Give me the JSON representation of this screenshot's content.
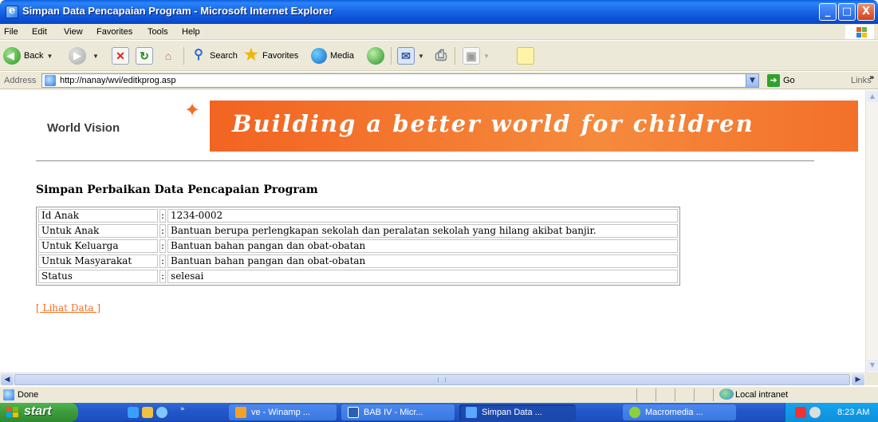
{
  "window": {
    "title": "Simpan Data Pencapaian Program - Microsoft Internet Explorer",
    "minimize": "_",
    "maximize": "□",
    "close": "X"
  },
  "menu": [
    "File",
    "Edit",
    "View",
    "Favorites",
    "Tools",
    "Help"
  ],
  "toolbar": {
    "back": "Back",
    "search": "Search",
    "favorites": "Favorites",
    "media": "Media"
  },
  "address": {
    "label": "Address",
    "url": "http://nanay/wvi/editkprog.asp",
    "go": "Go",
    "links": "Links"
  },
  "page": {
    "logo_text": "World Vision",
    "tagline": "Building a better world for children",
    "heading": "Simpan Perbaikan Data Pencapaian Program",
    "rows": [
      {
        "label": "Id Anak",
        "sep": ":",
        "value": "1234-0002"
      },
      {
        "label": "Untuk Anak",
        "sep": ":",
        "value": "Bantuan berupa perlengkapan sekolah dan peralatan sekolah yang hilang akibat banjir."
      },
      {
        "label": "Untuk Keluarga",
        "sep": ":",
        "value": "Bantuan bahan pangan dan obat-obatan"
      },
      {
        "label": "Untuk Masyarakat",
        "sep": ":",
        "value": "Bantuan bahan pangan dan obat-obatan"
      },
      {
        "label": "Status",
        "sep": ":",
        "value": "selesai"
      }
    ],
    "link": "[ Lihat Data ]"
  },
  "status": {
    "text": "Done",
    "zone": "Local intranet"
  },
  "taskbar": {
    "start": "start",
    "tasks": [
      "ve - Winamp ...",
      "BAB IV - Micr...",
      "Simpan Data ...",
      "Macromedia ..."
    ],
    "clock": "8:23 AM"
  },
  "colors": {
    "accent_orange": "#f26e22",
    "titlebar_blue": "#0b50d6",
    "link_orange": "#f26e22"
  }
}
